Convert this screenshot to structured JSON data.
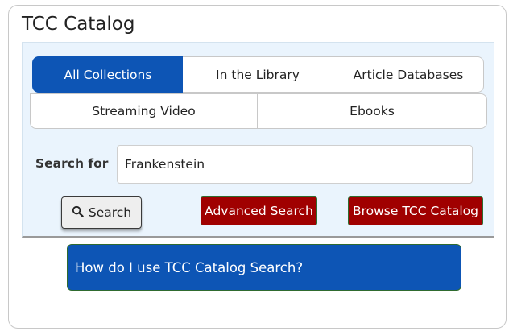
{
  "title": "TCC Catalog",
  "tabs": [
    {
      "label": "All Collections",
      "active": true
    },
    {
      "label": "In the Library",
      "active": false
    },
    {
      "label": "Article Databases",
      "active": false
    },
    {
      "label": "Streaming Video",
      "active": false
    },
    {
      "label": "Ebooks",
      "active": false
    }
  ],
  "search": {
    "label": "Search for",
    "value": "Frankenstein",
    "button_label": "Search",
    "button_icon": "search-icon"
  },
  "buttons": {
    "advanced_search": "Advanced Search",
    "browse_catalog": "Browse TCC Catalog"
  },
  "help": {
    "label": "How do I use TCC Catalog Search?"
  },
  "colors": {
    "primary_blue": "#0d55b5",
    "action_red": "#a00000",
    "panel_bg": "#eaf4fd"
  }
}
